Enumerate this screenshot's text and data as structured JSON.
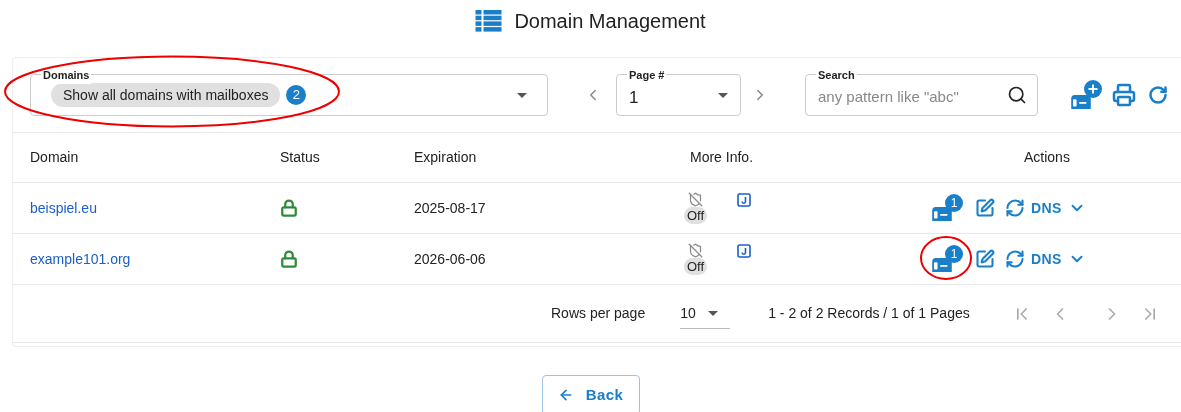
{
  "title": "Domain Management",
  "filters": {
    "domains": {
      "label": "Domains",
      "chip": "Show all domains with mailboxes",
      "count": "2"
    },
    "page": {
      "label": "Page #",
      "value": "1"
    },
    "search": {
      "label": "Search",
      "placeholder": "any pattern like \"abc\""
    }
  },
  "table": {
    "columns": [
      "Domain",
      "Status",
      "Expiration",
      "More Info.",
      "Actions"
    ],
    "rows": [
      {
        "domain": "beispiel.eu",
        "expiration": "2025-08-17",
        "protection": "Off",
        "mailbox_count": "1",
        "dns": "DNS",
        "highlighted": false
      },
      {
        "domain": "example101.org",
        "expiration": "2026-06-06",
        "protection": "Off",
        "mailbox_count": "1",
        "dns": "DNS",
        "highlighted": true
      }
    ]
  },
  "pagination": {
    "rows_label": "Rows per page",
    "rows_value": "10",
    "summary": "1 - 2 of 2 Records / 1 of 1 Pages"
  },
  "back_button": "Back",
  "annotations": {
    "domains_filter_circled": true
  }
}
